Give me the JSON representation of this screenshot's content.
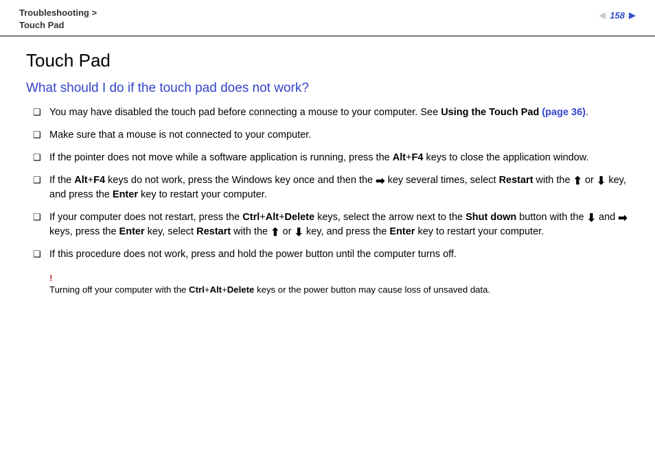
{
  "header": {
    "breadcrumb_parent": "Troubleshooting",
    "breadcrumb_sep": ">",
    "breadcrumb_child": "Touch Pad",
    "page_number": "158"
  },
  "title": "Touch Pad",
  "subtitle": "What should I do if the touch pad does not work?",
  "bullets": {
    "b1_pre": "You may have disabled the touch pad before connecting a mouse to your computer. See ",
    "b1_bold": "Using the Touch Pad ",
    "b1_link": "(page 36)",
    "b1_post": ".",
    "b2": "Make sure that a mouse is not connected to your computer.",
    "b3_pre": "If the pointer does not move while a software application is running, press the ",
    "b3_keys1_alt": "Alt",
    "b3_plus": "+",
    "b3_keys1_f4": "F4",
    "b3_post": " keys to close the application window.",
    "b4_pre": "If the ",
    "b4_alt": "Alt",
    "b4_plus": "+",
    "b4_f4": "F4",
    "b4_mid1": " keys do not work, press the Windows key once and then the ",
    "b4_mid2": " key several times, select ",
    "b4_restart": "Restart",
    "b4_mid3": " with the ",
    "b4_mid4": " or ",
    "b4_mid5": " key, and press the ",
    "b4_enter": "Enter",
    "b4_post": " key to restart your computer.",
    "b5_pre": "If your computer does not restart, press the ",
    "b5_ctrl": "Ctrl",
    "b5_plus": "+",
    "b5_alt": "Alt",
    "b5_delete": "Delete",
    "b5_mid1": " keys, select the arrow next to the ",
    "b5_shutdown": "Shut down",
    "b5_mid2": " button with the ",
    "b5_and": " and ",
    "b5_mid3": " keys, press the ",
    "b5_enter": "Enter",
    "b5_mid4": " key, select ",
    "b5_restart": "Restart",
    "b5_mid5": " with the ",
    "b5_or": " or ",
    "b5_mid6": " key, and press the ",
    "b5_post": " key to restart your computer.",
    "b6": "If this procedure does not work, press and hold the power button until the computer turns off."
  },
  "note": {
    "exclam": "!",
    "pre": "Turning off your computer with the ",
    "ctrl": "Ctrl",
    "plus": "+",
    "alt": "Alt",
    "delete": "Delete",
    "post": " keys or the power button may cause loss of unsaved data."
  },
  "arrows": {
    "right": "➡",
    "up": "⬆",
    "down": "⬇"
  }
}
